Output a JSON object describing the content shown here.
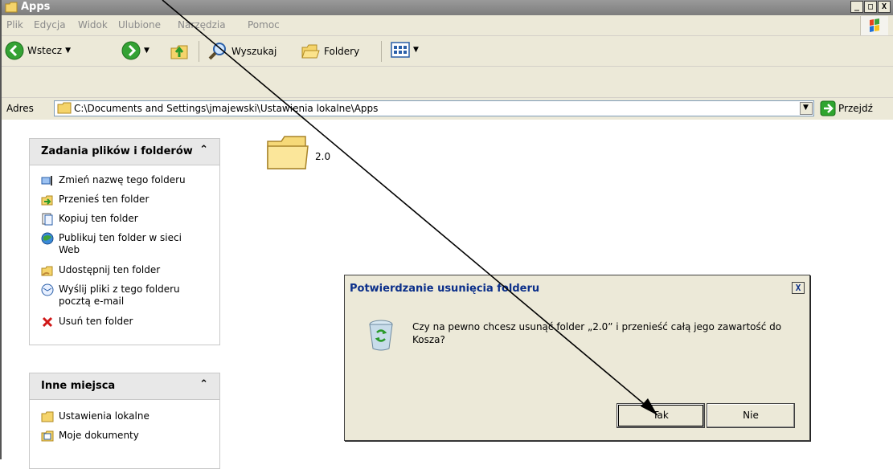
{
  "window": {
    "title": "Apps"
  },
  "menubar": {
    "items": [
      "Plik",
      "Edycja",
      "Widok",
      "Ulubione",
      "Narzędzia",
      "Pomoc"
    ]
  },
  "toolbar": {
    "back_label": "Wstecz",
    "search_label": "Wyszukaj",
    "folders_label": "Foldery"
  },
  "address": {
    "label": "Adres",
    "value": "C:\\Documents and Settings\\jmajewski\\Ustawienia lokalne\\Apps",
    "go_label": "Przejdź"
  },
  "tasks_pane": {
    "title": "Zadania plików i folderów",
    "items": [
      {
        "label": "Zmień nazwę tego folderu",
        "icon": "rename-icon"
      },
      {
        "label": "Przenieś ten folder",
        "icon": "move-icon"
      },
      {
        "label": "Kopiuj ten folder",
        "icon": "copy-icon"
      },
      {
        "label": "Publikuj ten folder w sieci Web",
        "icon": "publish-web-icon"
      },
      {
        "label": "Udostępnij ten folder",
        "icon": "share-icon"
      },
      {
        "label": "Wyślij pliki z tego folderu pocztą e-mail",
        "icon": "email-icon"
      },
      {
        "label": "Usuń ten folder",
        "icon": "delete-icon"
      }
    ]
  },
  "other_places_pane": {
    "title": "Inne miejsca",
    "items": [
      {
        "label": "Ustawienia lokalne",
        "icon": "folder-icon"
      },
      {
        "label": "Moje dokumenty",
        "icon": "documents-icon"
      }
    ]
  },
  "folder": {
    "name": "2.0"
  },
  "dialog": {
    "title": "Potwierdzanie usunięcia folderu",
    "message": "Czy na pewno chcesz usunąć folder „2.0” i przenieść całą jego zawartość do Kosza?",
    "yes_label": "Tak",
    "no_label": "Nie",
    "icon": "recycle-bin-icon"
  },
  "colors": {
    "window_bg": "#ece9d8",
    "titlebar": "#8a8a8a",
    "dialog_title_text": "#0b2f8a",
    "go_green": "#2fa52f",
    "back_green": "#34a234",
    "delete_red": "#d01818"
  }
}
